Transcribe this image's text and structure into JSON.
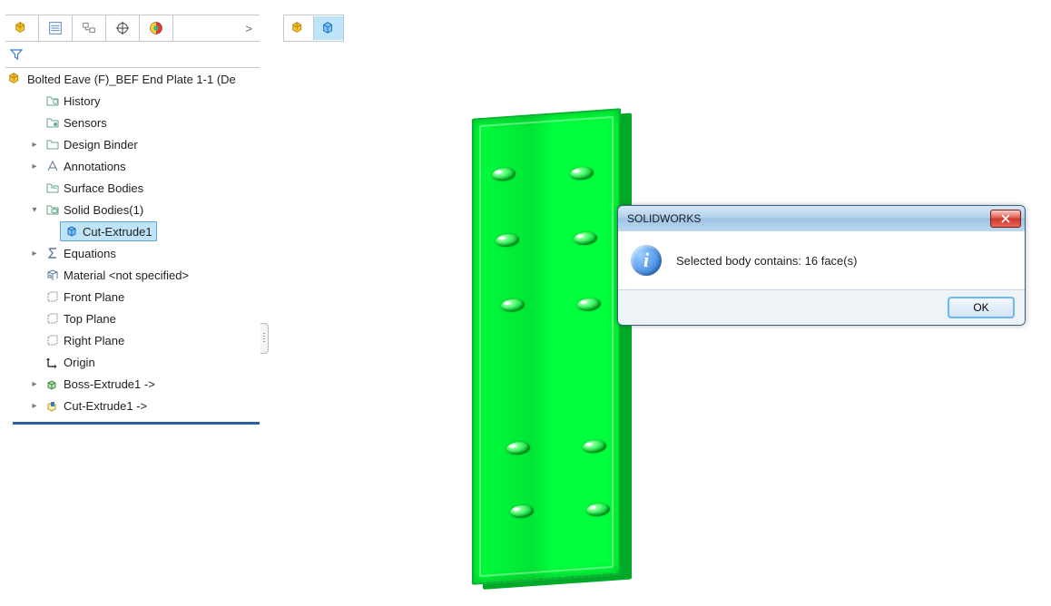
{
  "tabs": {
    "overflow": ">"
  },
  "root": {
    "label": "Bolted Eave (F)_BEF End Plate 1-1  (De"
  },
  "tree": {
    "history": "History",
    "sensors": "Sensors",
    "designBinder": "Design Binder",
    "annotations": "Annotations",
    "surfaceBodies": "Surface Bodies",
    "solidBodies": "Solid Bodies(1)",
    "cutExtrudeBody": "Cut-Extrude1",
    "equations": "Equations",
    "material": "Material <not specified>",
    "frontPlane": "Front Plane",
    "topPlane": "Top Plane",
    "rightPlane": "Right Plane",
    "origin": "Origin",
    "bossExtrude": "Boss-Extrude1 ->",
    "cutExtrudeFeat": "Cut-Extrude1 ->"
  },
  "dialog": {
    "title": "SOLIDWORKS",
    "message": "Selected body contains: 16 face(s)",
    "ok": "OK"
  }
}
